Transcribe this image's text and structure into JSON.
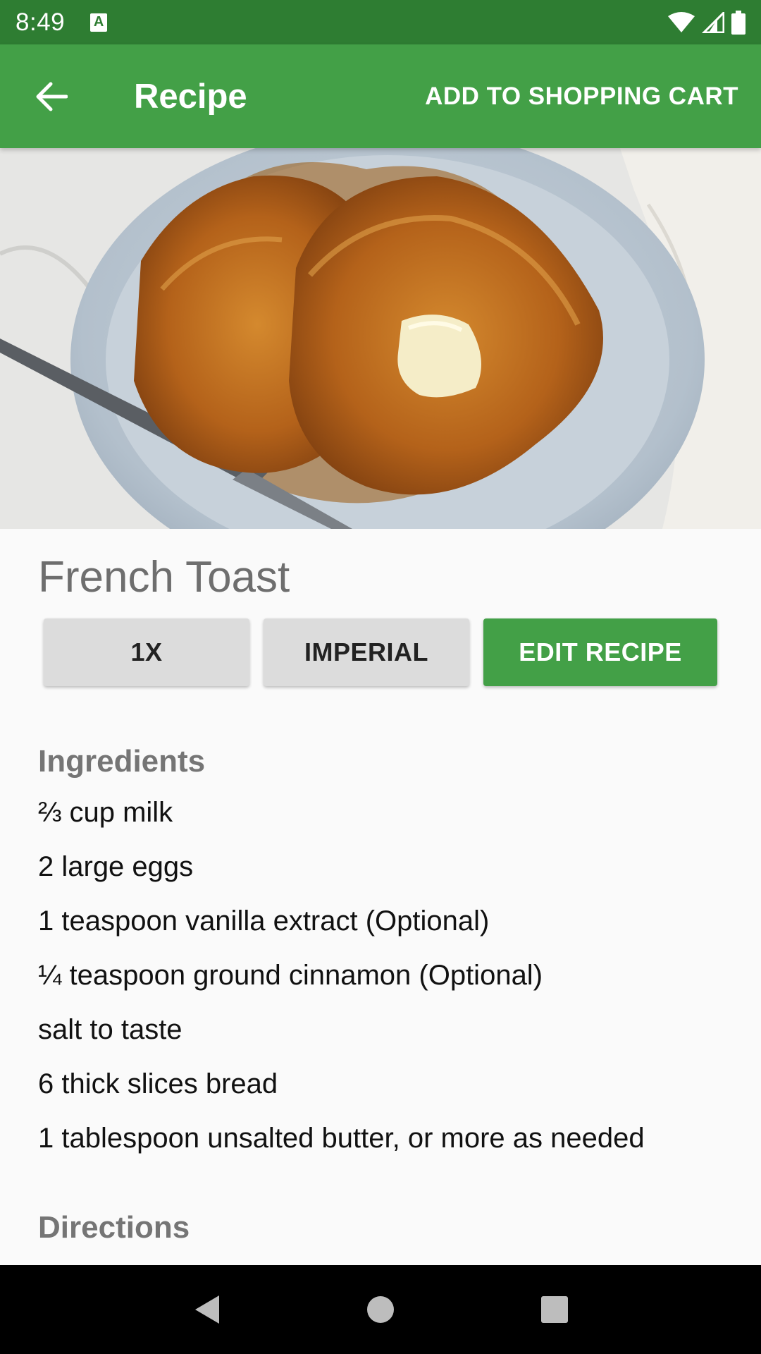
{
  "status_bar": {
    "time": "8:49",
    "icons": [
      "notification-a-icon",
      "wifi-icon",
      "cell-signal-icon",
      "battery-icon"
    ]
  },
  "app_bar": {
    "title": "Recipe",
    "back_icon": "arrow-back-icon",
    "action_label": "ADD TO SHOPPING CART"
  },
  "hero": {
    "image_name": "french-toast-photo"
  },
  "recipe": {
    "title": "French Toast",
    "buttons": {
      "scale": "1X",
      "units": "IMPERIAL",
      "edit": "EDIT RECIPE"
    },
    "ingredients_heading": "Ingredients",
    "ingredients": [
      "⅔ cup milk",
      "2 large eggs",
      "1 teaspoon vanilla extract (Optional)",
      "¼ teaspoon ground cinnamon (Optional)",
      "salt to taste",
      "6 thick slices bread",
      "1 tablespoon unsalted butter, or more as needed"
    ],
    "directions_heading": "Directions"
  },
  "nav_bar": {
    "icons": [
      "back-triangle-icon",
      "home-circle-icon",
      "recents-square-icon"
    ]
  },
  "colors": {
    "status_bar": "#2e7d32",
    "app_bar": "#43a047",
    "accent_button": "#43a047",
    "neutral_button": "#dcdcdc"
  }
}
